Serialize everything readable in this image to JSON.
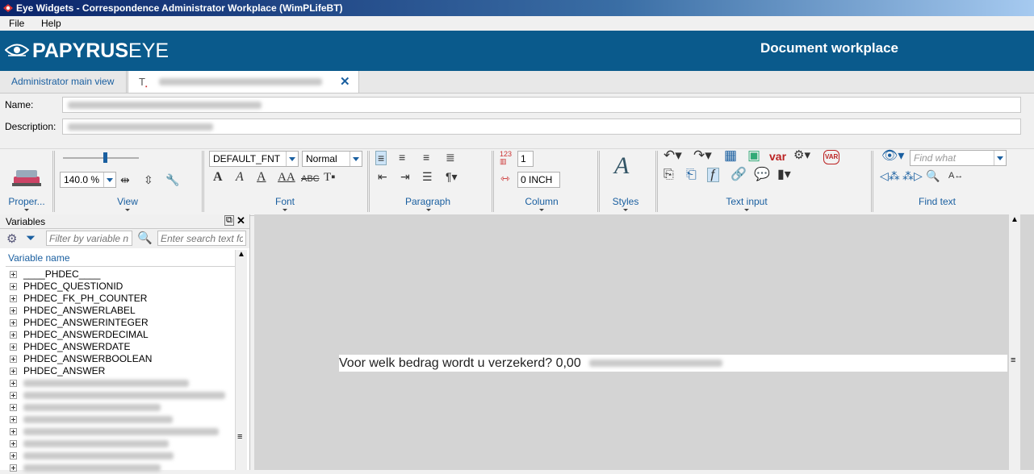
{
  "window": {
    "title": "Eye Widgets - Correspondence Administrator Workplace (WimPLifeBT)"
  },
  "menu": [
    "File",
    "Help"
  ],
  "banner": {
    "logo_bold": "PAPYRUS",
    "logo_light": "EYE",
    "title": "Document workplace"
  },
  "tabs": [
    {
      "label": "Administrator main view"
    },
    {
      "label": ""
    }
  ],
  "form": {
    "name_label": "Name:",
    "description_label": "Description:"
  },
  "ribbon": {
    "groups": [
      "Proper...",
      "View",
      "Font",
      "Paragraph",
      "Column",
      "Styles",
      "Text input",
      "Find text"
    ],
    "zoom": "140.0 %",
    "font_name": "DEFAULT_FNT",
    "font_style": "Normal",
    "column_count": "1",
    "column_spacing": "0 INCH",
    "find_placeholder": "Find what",
    "var_label": "var",
    "var_badge": "VAR"
  },
  "variables_panel": {
    "title": "Variables",
    "filter_placeholder": "Filter by variable n",
    "search_placeholder": "Enter search text fc",
    "column_header": "Variable name",
    "items": [
      "____PHDEC____",
      "PHDEC_QUESTIONID",
      "PHDEC_FK_PH_COUNTER",
      "PHDEC_ANSWERLABEL",
      "PHDEC_ANSWERINTEGER",
      "PHDEC_ANSWERDECIMAL",
      "PHDEC_ANSWERDATE",
      "PHDEC_ANSWERBOOLEAN",
      "PHDEC_ANSWER"
    ]
  },
  "editor": {
    "text": "Voor welk bedrag wordt u verzekerd? 0,00"
  },
  "colors": {
    "banner": "#0a5a8c",
    "accent": "#1a5fa0",
    "editor_bg": "#d4d4d4"
  }
}
